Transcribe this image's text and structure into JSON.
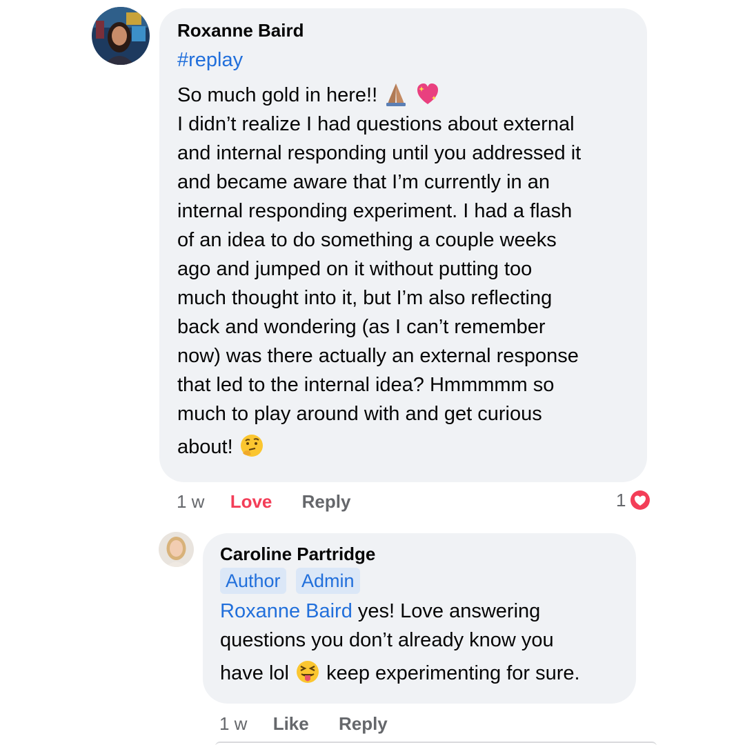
{
  "comments": [
    {
      "author": "Roxanne Baird",
      "tag": "#replay",
      "lines": [
        "So much gold in here!!",
        "I didn’t realize I had questions about external",
        "and internal responding until you addressed it",
        "and became aware that I’m currently in an",
        "internal responding experiment. I had a flash",
        "of an idea to do something a couple weeks",
        "ago and jumped on it without putting too",
        "much thought into it, but I’m also reflecting",
        "back and wondering (as I can’t remember",
        "now) was there actually an external response",
        "that led to the internal idea? Hmmmmm so",
        "much to play around with and get curious",
        "about!"
      ],
      "emojis": [
        "folded-hands-emoji",
        "sparkling-heart-emoji",
        "thinking-face-emoji"
      ],
      "time": "1 w",
      "actions": {
        "love": "Love",
        "reply": "Reply"
      },
      "reaction_count": "1",
      "reaction_icon": "heart-icon"
    },
    {
      "author": "Caroline Partridge",
      "badges": [
        "Author",
        "Admin"
      ],
      "mention": "Roxanne Baird",
      "lines": [
        " yes! Love answering",
        "questions you don’t already know you",
        "have lol",
        " keep experimenting for sure."
      ],
      "emojis": [
        "squinting-face-with-tongue-emoji"
      ],
      "time": "1 w",
      "actions": {
        "like": "Like",
        "reply": "Reply"
      }
    }
  ],
  "colors": {
    "bubble": "#f0f2f5",
    "link": "#216fdb",
    "love": "#f33e58",
    "meta": "#65676b",
    "badge_bg": "#dbe7f7"
  }
}
